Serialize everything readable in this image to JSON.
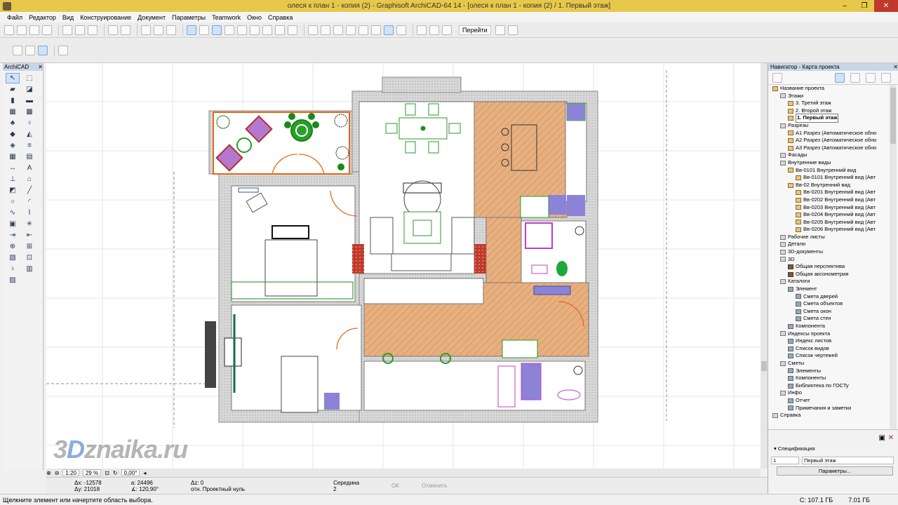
{
  "window": {
    "title": "олеся к план 1 - копия (2) - Graphisoft ArchiCAD-64 14 - [олеся к план 1 - копия (2) / 1. Первый этаж]",
    "min": "–",
    "max": "❐",
    "close": "✕"
  },
  "menu": [
    "Файл",
    "Редактор",
    "Вид",
    "Конструирование",
    "Документ",
    "Параметры",
    "Teamwork",
    "Окно",
    "Справка"
  ],
  "toolbar": {
    "goto_label": "Перейти"
  },
  "toolbox": {
    "title": "ArchiCAD"
  },
  "navigator": {
    "title": "Навигатор - Карта проекта",
    "tree": [
      {
        "label": "Название проекта",
        "level": 0,
        "icon": "project"
      },
      {
        "label": "Этажи",
        "level": 1,
        "icon": "folder"
      },
      {
        "label": "3. Третий этаж",
        "level": 2,
        "icon": "story"
      },
      {
        "label": "2. Второй этаж",
        "level": 2,
        "icon": "story"
      },
      {
        "label": "1. Первый этаж",
        "level": 2,
        "icon": "story",
        "selected": true
      },
      {
        "label": "Разрезы",
        "level": 1,
        "icon": "folder"
      },
      {
        "label": "A1 Разрез (Автоматическое обно",
        "level": 2,
        "icon": "story"
      },
      {
        "label": "A2 Разрез (Автоматическое обно",
        "level": 2,
        "icon": "story"
      },
      {
        "label": "A3 Разрез (Автоматическое обно",
        "level": 2,
        "icon": "story"
      },
      {
        "label": "Фасады",
        "level": 1,
        "icon": "folder"
      },
      {
        "label": "Внутренние виды",
        "level": 1,
        "icon": "folder"
      },
      {
        "label": "Вв-0101 Внутренний вид",
        "level": 2,
        "icon": "story"
      },
      {
        "label": "Вв-0101 Внутренний вид (Авт",
        "level": 3,
        "icon": "story"
      },
      {
        "label": "Вв-02 Внутренний вид",
        "level": 2,
        "icon": "story"
      },
      {
        "label": "Вв-0201 Внутренний вид (Авт",
        "level": 3,
        "icon": "story"
      },
      {
        "label": "Вв-0202 Внутренний вид (Авт",
        "level": 3,
        "icon": "story"
      },
      {
        "label": "Вв-0203 Внутренний вид (Авт",
        "level": 3,
        "icon": "story"
      },
      {
        "label": "Вв-0204 Внутренний вид (Авт",
        "level": 3,
        "icon": "story"
      },
      {
        "label": "Вв-0205 Внутренний вид (Авт",
        "level": 3,
        "icon": "story"
      },
      {
        "label": "Вв-0206 Внутренний вид (Авт",
        "level": 3,
        "icon": "story"
      },
      {
        "label": "Рабочие листы",
        "level": 1,
        "icon": "folder"
      },
      {
        "label": "Детали",
        "level": 1,
        "icon": "folder"
      },
      {
        "label": "3D-документы",
        "level": 1,
        "icon": "folder"
      },
      {
        "label": "3D",
        "level": 1,
        "icon": "folder"
      },
      {
        "label": "Общая перспектива",
        "level": 2,
        "icon": "3d"
      },
      {
        "label": "Общая аксонометрия",
        "level": 2,
        "icon": "3d"
      },
      {
        "label": "Каталоги",
        "level": 1,
        "icon": "folder"
      },
      {
        "label": "Элемент",
        "level": 2,
        "icon": "gray"
      },
      {
        "label": "Смета дверей",
        "level": 3,
        "icon": "gray"
      },
      {
        "label": "Смета объектов",
        "level": 3,
        "icon": "gray"
      },
      {
        "label": "Смета окон",
        "level": 3,
        "icon": "gray"
      },
      {
        "label": "Смета стен",
        "level": 3,
        "icon": "gray"
      },
      {
        "label": "Компонента",
        "level": 2,
        "icon": "gray"
      },
      {
        "label": "Индексы проекта",
        "level": 1,
        "icon": "folder"
      },
      {
        "label": "Индекс листов",
        "level": 2,
        "icon": "gray"
      },
      {
        "label": "Список видов",
        "level": 2,
        "icon": "gray"
      },
      {
        "label": "Список чертежей",
        "level": 2,
        "icon": "gray"
      },
      {
        "label": "Сметы",
        "level": 1,
        "icon": "folder"
      },
      {
        "label": "Элементы",
        "level": 2,
        "icon": "gray"
      },
      {
        "label": "Компоненты",
        "level": 2,
        "icon": "gray"
      },
      {
        "label": "Библиотека по ГОСТу",
        "level": 2,
        "icon": "gray"
      },
      {
        "label": "Инфо",
        "level": 1,
        "icon": "folder"
      },
      {
        "label": "Отчет",
        "level": 2,
        "icon": "gray"
      },
      {
        "label": "Примечания и заметки",
        "level": 2,
        "icon": "gray"
      },
      {
        "label": "Справка",
        "level": 0,
        "icon": "folder"
      }
    ],
    "spec_label": "Спецификация",
    "spec_index": "1",
    "spec_name": "Первый этаж",
    "params_button": "Параметры..."
  },
  "view": {
    "scale": "1:20",
    "zoom": "29 %",
    "angle": "0,00°"
  },
  "coords": {
    "dx": "Δx: -12578",
    "dy": "Δy: 21018",
    "a": "a: 24496",
    "angle": "∡: 120,90°",
    "dz": "Δz: 0",
    "ref": "отн. Проектный нуль",
    "snap": "Середина",
    "snap_n": "2",
    "ok": "ОК",
    "cancel": "Отменить"
  },
  "status": {
    "hint": "Щелкните элемент или начертите область выбора.",
    "disk_c": "C: 107.1 ГБ",
    "disk_other": "7.01 ГБ"
  },
  "watermark": {
    "part1": "3",
    "part2": "D",
    "part3": "znaika.ru"
  }
}
